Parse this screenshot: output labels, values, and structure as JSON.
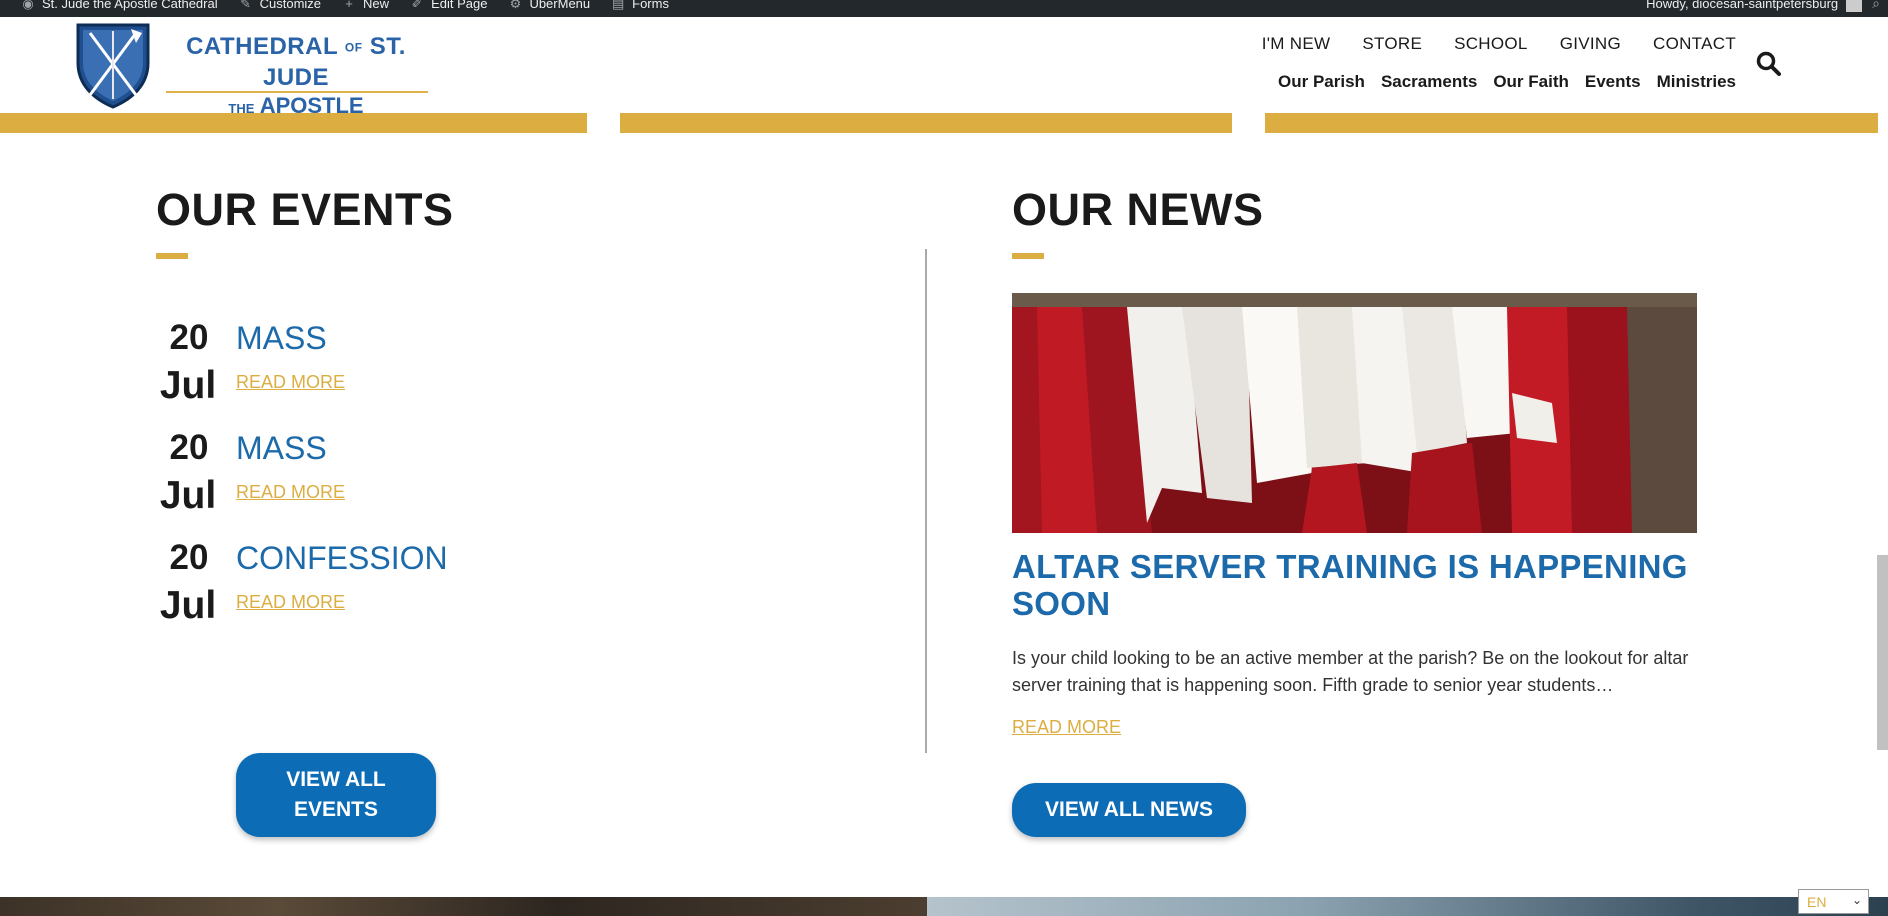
{
  "admin_bar": {
    "items": [
      {
        "icon": "wordpress-icon",
        "label": "St. Jude the Apostle Cathedral"
      },
      {
        "icon": "brush-icon",
        "label": "Customize"
      },
      {
        "icon": "plus-icon",
        "label": "New"
      },
      {
        "icon": "pencil-icon",
        "label": "Edit Page"
      },
      {
        "icon": "gears-icon",
        "label": "UberMenu"
      },
      {
        "icon": "forms-icon",
        "label": "Forms"
      }
    ],
    "howdy": "Howdy, diocesan-saintpetersburg"
  },
  "logo": {
    "line1_a": "CATHEDRAL",
    "line1_of": "OF",
    "line1_b": "ST. JUDE",
    "line2_the": "THE",
    "line2_b": "APOSTLE"
  },
  "nav": {
    "top": [
      "I'M NEW",
      "STORE",
      "SCHOOL",
      "GIVING",
      "CONTACT"
    ],
    "bottom": [
      "Our Parish",
      "Sacraments",
      "Our Faith",
      "Events",
      "Ministries"
    ]
  },
  "events": {
    "title": "OUR EVENTS",
    "items": [
      {
        "day": "20",
        "month": "Jul",
        "title": "MASS",
        "more": "READ MORE"
      },
      {
        "day": "20",
        "month": "Jul",
        "title": "MASS",
        "more": "READ MORE"
      },
      {
        "day": "20",
        "month": "Jul",
        "title": "CONFESSION",
        "more": "READ MORE"
      }
    ],
    "button_line1": "VIEW ALL",
    "button_line2": "EVENTS"
  },
  "news": {
    "title": "OUR NEWS",
    "headline": "ALTAR SERVER TRAINING IS HAPPENING SOON",
    "excerpt": "Is your child looking to be an active member at the parish? Be on the lookout for altar server training that is happening soon. Fifth grade to senior year students…",
    "more": "READ MORE",
    "button": "VIEW ALL NEWS"
  },
  "language": {
    "selected": "EN"
  },
  "colors": {
    "gold": "#dcae42",
    "blue": "#1c6aaa",
    "button_blue": "#0c6cb5",
    "admin_bar": "#23282d"
  }
}
